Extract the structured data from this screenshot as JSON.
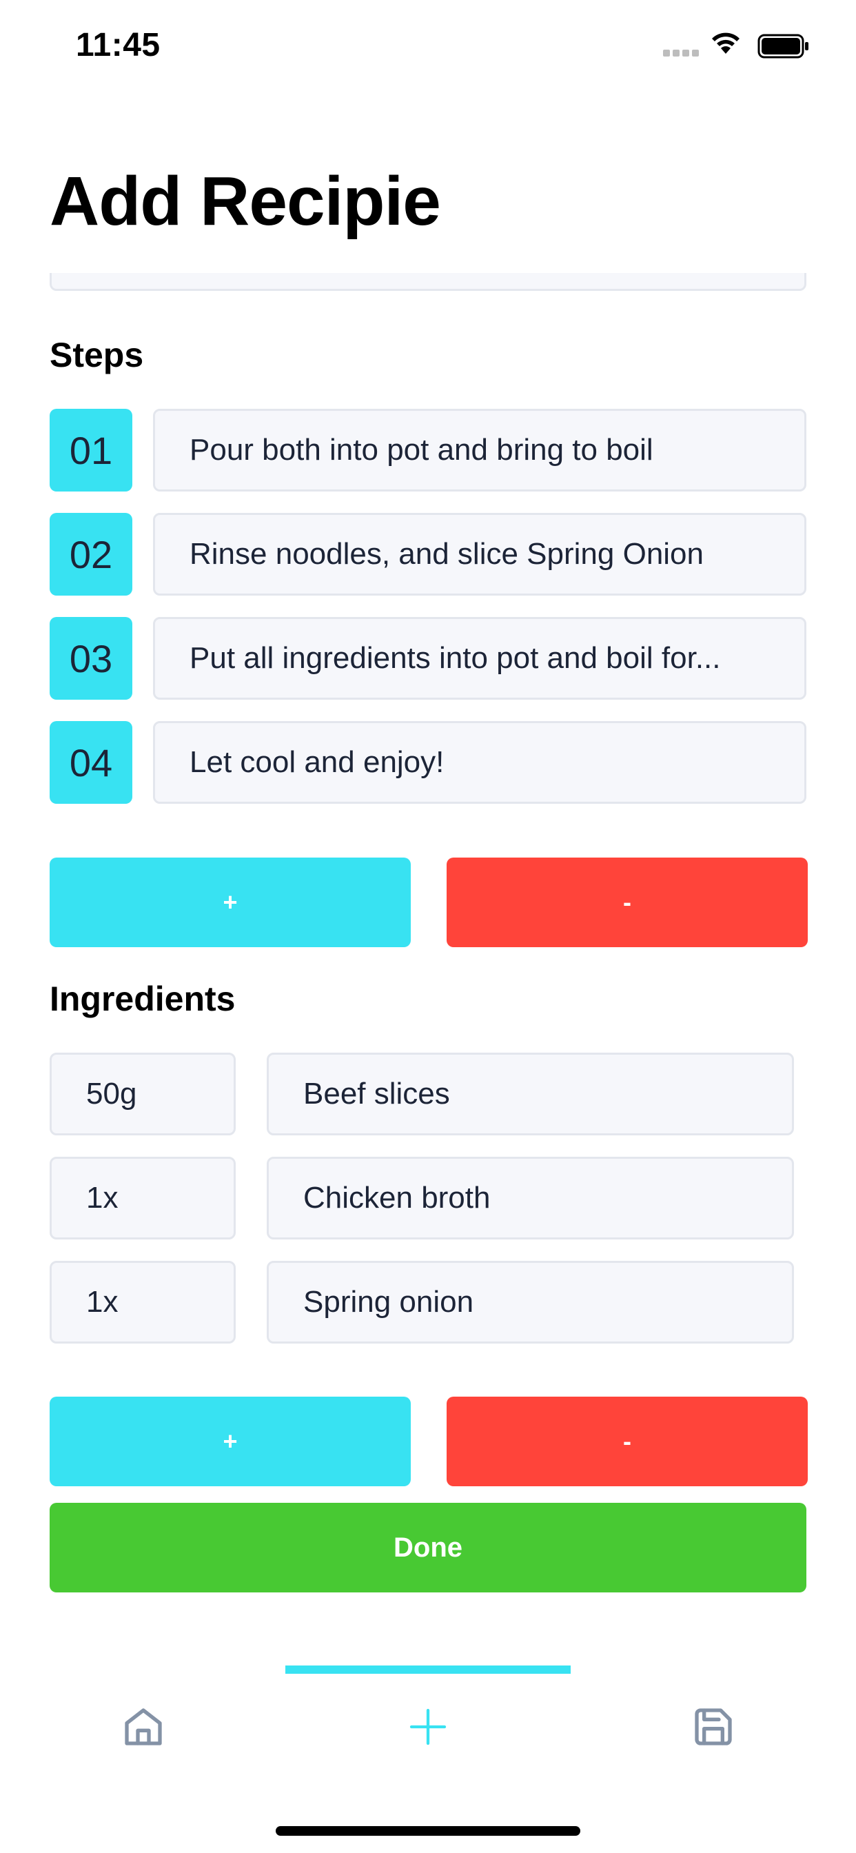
{
  "status_bar": {
    "time": "11:45"
  },
  "header": {
    "title": "Add Recipie"
  },
  "steps_section": {
    "title": "Steps",
    "steps": [
      {
        "number": "01",
        "text": "Pour both into pot and bring to boil"
      },
      {
        "number": "02",
        "text": "Rinse noodles, and slice Spring Onion"
      },
      {
        "number": "03",
        "text": "Put all ingredients into pot and boil for..."
      },
      {
        "number": "04",
        "text": "Let cool and enjoy!"
      }
    ],
    "add_label": "+",
    "remove_label": "-"
  },
  "ingredients_section": {
    "title": "Ingredients",
    "items": [
      {
        "quantity": "50g",
        "name": "Beef slices"
      },
      {
        "quantity": "1x",
        "name": "Chicken broth"
      },
      {
        "quantity": "1x",
        "name": "Spring onion"
      }
    ],
    "add_label": "+",
    "remove_label": "-"
  },
  "done_label": "Done",
  "tab_bar": {
    "tabs": [
      {
        "icon": "home-icon"
      },
      {
        "icon": "plus-icon",
        "active": true
      },
      {
        "icon": "save-icon"
      }
    ]
  },
  "colors": {
    "accent": "#38e2f2",
    "danger": "#ff443a",
    "success": "#48c933",
    "field_bg": "#f6f7fb",
    "inactive_icon": "#8492a6"
  }
}
